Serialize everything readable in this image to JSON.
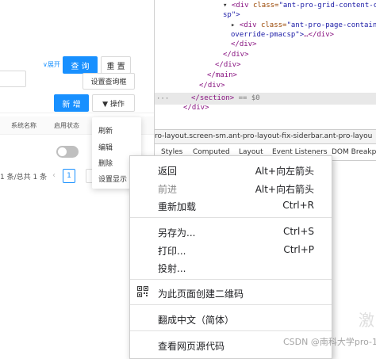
{
  "app": {
    "expand_label": "∨展开",
    "query_button": "查 询",
    "reset_button": "重 置",
    "set_query_box_button": "设置查询框",
    "new_button": "新 增",
    "action_button": "▼  操作",
    "columns": [
      "系统名称",
      "启用状态"
    ],
    "pager_text": "1 条/总共 1 条",
    "prev_icon": "‹",
    "page_current": "1",
    "dropdown_items": [
      "刷新",
      "编辑",
      "删除",
      "设置显示"
    ]
  },
  "devtools": {
    "lines": [
      {
        "indent": 86,
        "tri": "▾",
        "tag_open": "<div ",
        "attr": "class",
        "val": "\"ant-pro-grid-content-chi",
        "rest": ""
      },
      {
        "indent": 86,
        "tri": "",
        "tag_open": "",
        "attr": "",
        "val": "sp\">",
        "rest": ""
      },
      {
        "indent": 96,
        "tri": "▸",
        "tag_open": "<div ",
        "attr": "class",
        "val": "\"ant-pro-page-container-",
        "rest": ""
      },
      {
        "indent": 96,
        "tri": "",
        "tag_open": "",
        "attr": "",
        "val": "override-pmacsp\">",
        "rest": "…</div>"
      },
      {
        "indent": 96,
        "tri": "",
        "tag_open": "</div>",
        "attr": "",
        "val": "",
        "rest": ""
      },
      {
        "indent": 86,
        "tri": "",
        "tag_open": "</div>",
        "attr": "",
        "val": "",
        "rest": ""
      },
      {
        "indent": 76,
        "tri": "",
        "tag_open": "</div>",
        "attr": "",
        "val": "",
        "rest": ""
      },
      {
        "indent": 66,
        "tri": "",
        "tag_open": "</main>",
        "attr": "",
        "val": "",
        "rest": ""
      },
      {
        "indent": 56,
        "tri": "",
        "tag_open": "</div>",
        "attr": "",
        "val": "",
        "rest": ""
      },
      {
        "indent": 46,
        "tri": "",
        "tag_open": "</section>",
        "attr": "",
        "val": "",
        "rest": " == $0"
      },
      {
        "indent": 36,
        "tri": "",
        "tag_open": "</div>",
        "attr": "",
        "val": "",
        "rest": ""
      }
    ],
    "ellipsis": "···",
    "breadcrumb": "ro-layout.screen-sm.ant-pro-layout-fix-siderbar.ant-pro-layou",
    "tabs": [
      "Styles",
      "Computed",
      "Layout",
      "Event Listeners",
      "DOM Breakpo"
    ]
  },
  "context_menu": {
    "items": [
      {
        "label": "返回",
        "shortcut": "Alt+向左箭头",
        "disabled": false
      },
      {
        "label": "前进",
        "shortcut": "Alt+向右箭头",
        "disabled": true
      },
      {
        "label": "重新加载",
        "shortcut": "Ctrl+R",
        "disabled": false
      },
      {
        "label": "另存为...",
        "shortcut": "Ctrl+S",
        "disabled": false
      },
      {
        "label": "打印...",
        "shortcut": "Ctrl+P",
        "disabled": false
      },
      {
        "label": "投射...",
        "shortcut": "",
        "disabled": false
      },
      {
        "label": "为此页面创建二维码",
        "shortcut": "",
        "disabled": false
      },
      {
        "label": "翻成中文（简体）",
        "shortcut": "",
        "disabled": false
      },
      {
        "label": "查看网页源代码",
        "shortcut": "",
        "disabled": false
      }
    ]
  },
  "watermark": "CSDN @南科大学pro-1",
  "watermark_corner": "激"
}
